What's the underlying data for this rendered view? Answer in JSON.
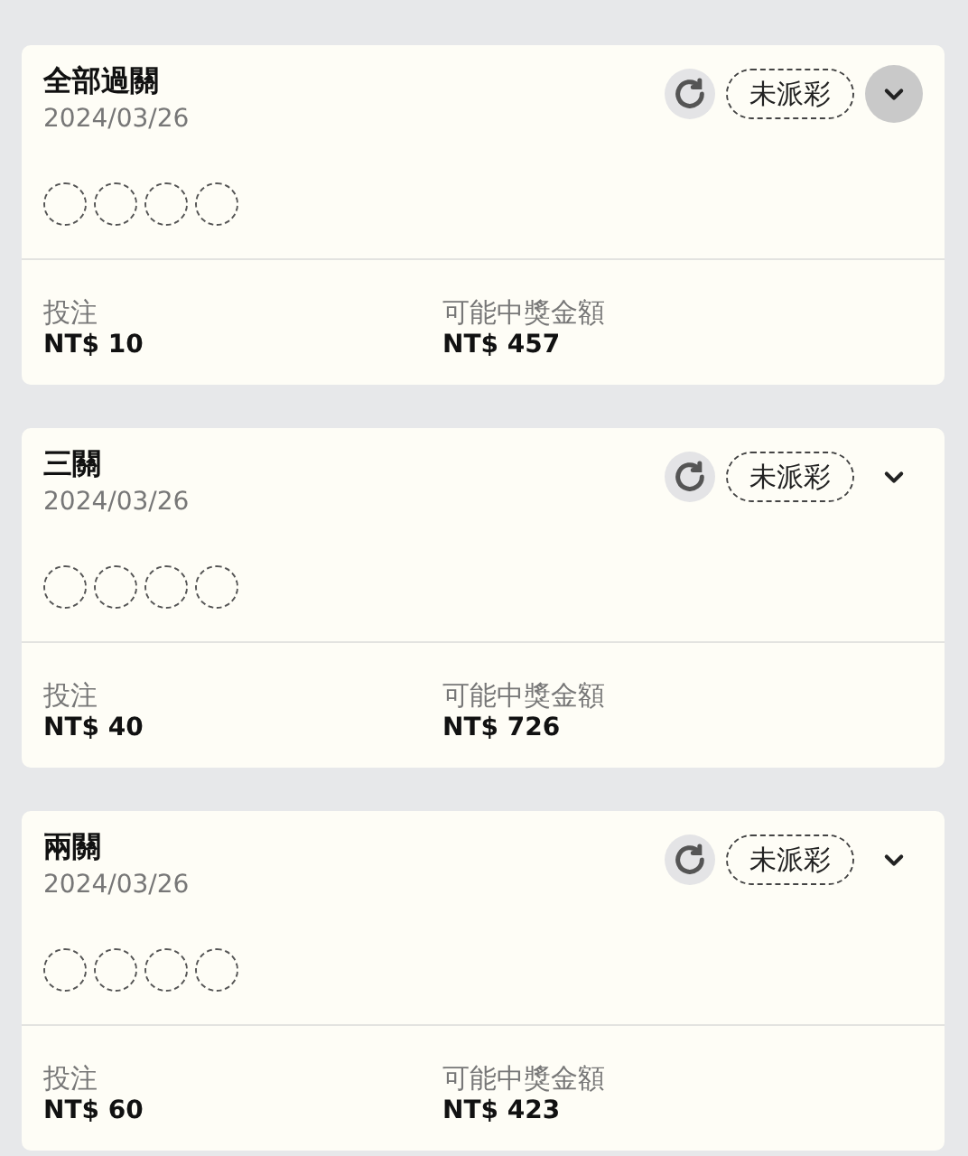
{
  "bets": [
    {
      "title": "全部過關",
      "date": "2024/03/26",
      "status": "未派彩",
      "expanded": true,
      "stake_label": "投注",
      "stake": "NT$ 10",
      "payout_label": "可能中獎金額",
      "payout": "NT$ 457"
    },
    {
      "title": "三關",
      "date": "2024/03/26",
      "status": "未派彩",
      "expanded": false,
      "stake_label": "投注",
      "stake": "NT$ 40",
      "payout_label": "可能中獎金額",
      "payout": "NT$ 726"
    },
    {
      "title": "兩關",
      "date": "2024/03/26",
      "status": "未派彩",
      "expanded": false,
      "stake_label": "投注",
      "stake": "NT$ 60",
      "payout_label": "可能中獎金額",
      "payout": "NT$ 423"
    }
  ]
}
